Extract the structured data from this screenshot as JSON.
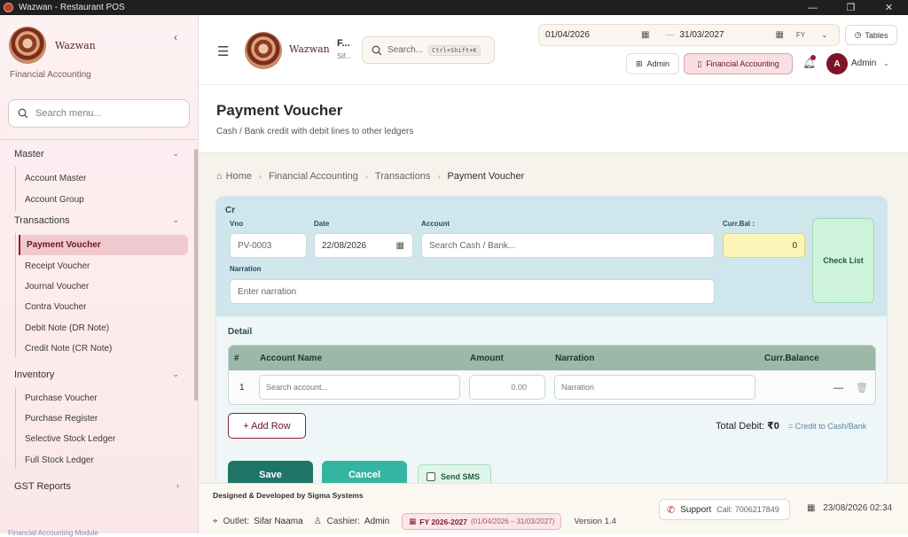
{
  "window": {
    "title": "Wazwan - Restaurant POS",
    "minimize": "—",
    "maximize": "❐",
    "close": "✕"
  },
  "sidebar": {
    "brand": "Wazwan",
    "module": "Financial Accounting",
    "search_placeholder": "Search menu...",
    "groups": [
      {
        "label": "Master",
        "items": [
          "Account Master",
          "Account Group"
        ]
      },
      {
        "label": "Transactions",
        "items": [
          "Payment Voucher",
          "Receipt Voucher",
          "Journal Voucher",
          "Contra Voucher",
          "Debit Note (DR Note)",
          "Credit Note (CR Note)"
        ]
      },
      {
        "label": "Inventory",
        "items": [
          "Purchase Voucher",
          "Purchase Register",
          "Selective Stock Ledger",
          "Full Stock Ledger"
        ]
      },
      {
        "label": "GST Reports",
        "items": []
      }
    ],
    "active_item": "Payment Voucher",
    "footer": "Financial Accounting Module"
  },
  "header": {
    "brand": "Wazwan",
    "sub_title": "F...",
    "sub_sub": "Sif...",
    "search_placeholder": "Search...",
    "search_shortcut": "Ctrl+Shift+K",
    "date_from": "01/04/2026",
    "date_to": "31/03/2027",
    "fy": "FY",
    "tables": "Tables",
    "admin_label": "Admin",
    "module_label": "Financial Accounting",
    "avatar_initial": "A",
    "user": "Admin"
  },
  "page": {
    "title": "Payment Voucher",
    "subtitle": "Cash / Bank credit with debit lines to other ledgers"
  },
  "breadcrumb": [
    "Home",
    "Financial Accounting",
    "Transactions",
    "Payment Voucher"
  ],
  "form": {
    "cr_label": "Cr",
    "vno_label": "Vno",
    "vno": "PV-0003",
    "date_label": "Date",
    "date": "22/08/2026",
    "account_label": "Account",
    "account_placeholder": "Search Cash / Bank...",
    "curbal_label": "Curr.Bal :",
    "curbal": "0",
    "checklist": "Check List",
    "narration_label": "Narration",
    "narration_placeholder": "Enter narration"
  },
  "detail": {
    "label": "Detail",
    "columns": [
      "#",
      "Account Name",
      "Amount",
      "Narration",
      "Curr.Balance"
    ],
    "rows": [
      {
        "no": "1",
        "account_placeholder": "Search account...",
        "amount_placeholder": "0.00",
        "narration_placeholder": "Narration",
        "minus": "—"
      }
    ],
    "add_row": "+ Add Row",
    "total_label": "Total Debit:",
    "total_value": "₹0",
    "total_note": "= Credit to Cash/Bank"
  },
  "actions": {
    "save": "Save",
    "cancel": "Cancel",
    "send_sms": "Send SMS"
  },
  "footer": {
    "designed": "Designed & Developed by Sigma Systems",
    "outlet_label": "Outlet:",
    "outlet": "Sifar Naama",
    "cashier_label": "Cashier:",
    "cashier": "Admin",
    "fy": "FY 2026-2027",
    "fy_range": "(01/04/2026 – 31/03/2027)",
    "version": "Version 1.4",
    "support_label": "Support",
    "support_call": "Call: 7006217849",
    "datetime": "23/08/2026 02:34"
  }
}
